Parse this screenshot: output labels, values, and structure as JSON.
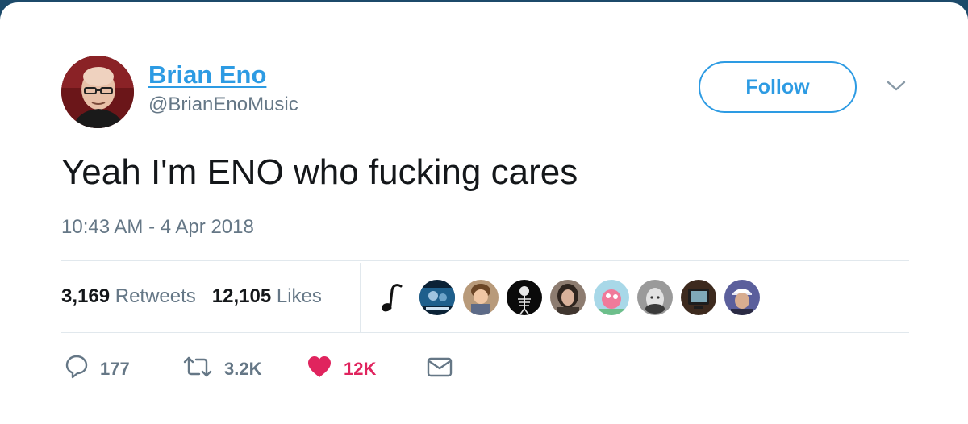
{
  "user": {
    "display_name": "Brian Eno",
    "handle": "@BrianEnoMusic",
    "avatar_icon": "profile-photo"
  },
  "follow_label": "Follow",
  "tweet": {
    "text": "Yeah I'm ENO who fucking cares",
    "timestamp": "10:43 AM - 4 Apr 2018"
  },
  "stats": {
    "retweets_count": "3,169",
    "retweets_label": "Retweets",
    "likes_count": "12,105",
    "likes_label": "Likes"
  },
  "likers": [
    {
      "icon": "music-note-avatar"
    },
    {
      "icon": "blue-scene-avatar"
    },
    {
      "icon": "child-photo-avatar"
    },
    {
      "icon": "skeleton-avatar"
    },
    {
      "icon": "woman-photo-avatar"
    },
    {
      "icon": "pink-scene-avatar"
    },
    {
      "icon": "upside-down-face-avatar"
    },
    {
      "icon": "screen-avatar"
    },
    {
      "icon": "man-cap-avatar"
    }
  ],
  "actions": {
    "reply_count": "177",
    "retweet_count": "3.2K",
    "like_count": "12K"
  },
  "colors": {
    "accent": "#2d9be3",
    "like": "#e0245e",
    "secondary_text": "#657786",
    "divider": "#e1e8ed"
  }
}
